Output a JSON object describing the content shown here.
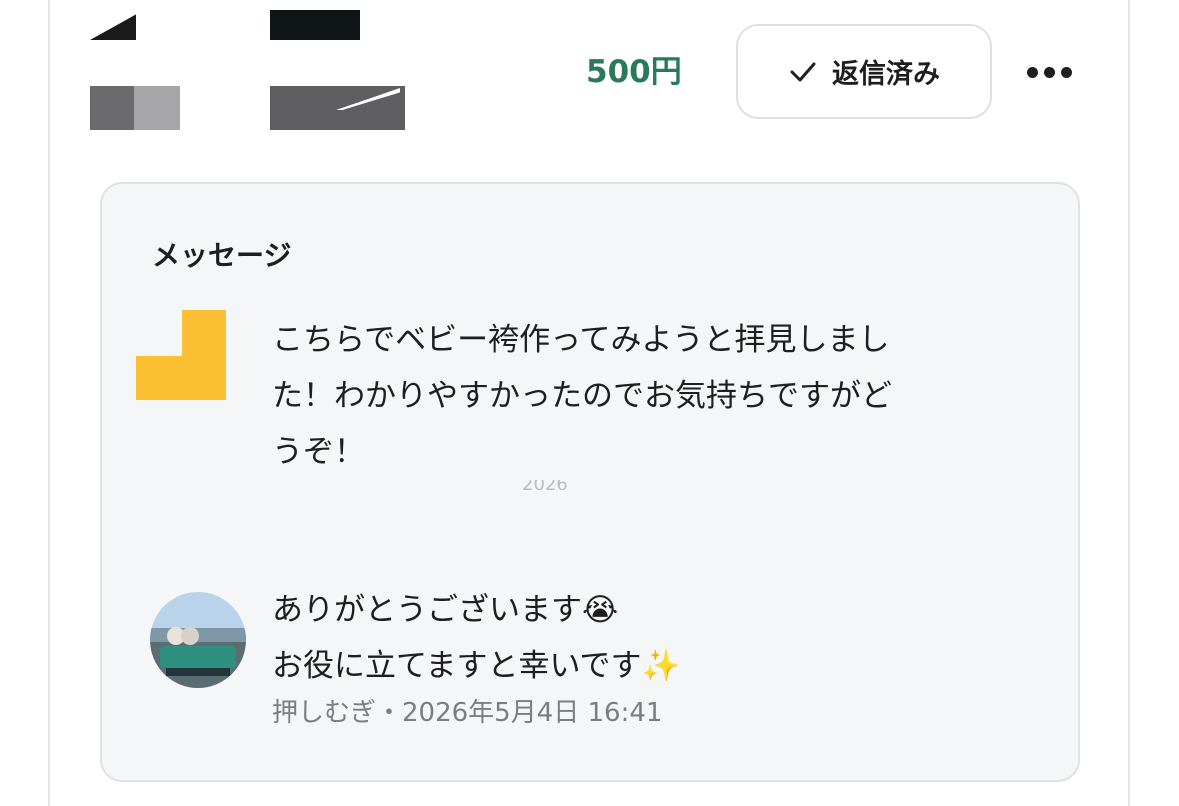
{
  "header": {
    "price": "500円",
    "reply_button_label": "返信済み",
    "reply_button_icon": "check-icon",
    "more_icon": "more-horizontal-icon"
  },
  "message_card": {
    "title": "メッセージ",
    "message": {
      "line1": "こちらでベビー袴作ってみようと拝見しまし",
      "line2": "た！わかりやすかったのでお気持ちですがど",
      "line3": "うぞ！",
      "faint_timestamp": "2026"
    },
    "reply": {
      "line1": "ありがとうございます😭",
      "line2": "お役に立てますと幸いです✨",
      "meta": "押しむぎ・2026年5月4日 16:41"
    }
  },
  "colors": {
    "price": "#2a7a5a",
    "card_background": "#f5f6f8",
    "sender_avatar": "#fbbf32"
  }
}
